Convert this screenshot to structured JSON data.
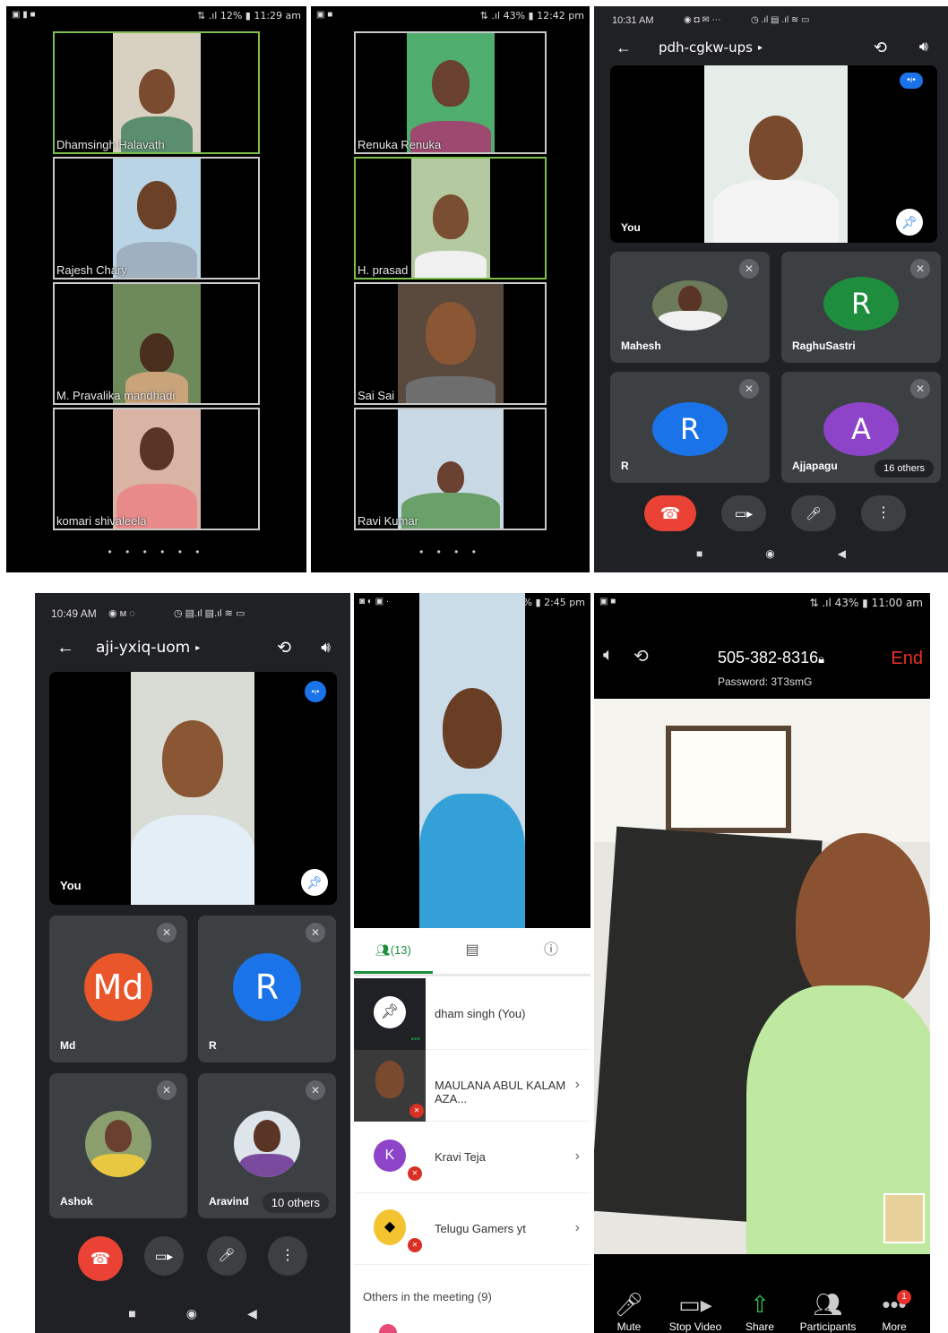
{
  "panel1": {
    "status_right": "⇅ .ıl 12% ▮ 11:29 am",
    "tiles": [
      {
        "name": "Dhamsingh Halavath"
      },
      {
        "name": "Rajesh Chary"
      },
      {
        "name": "M. Pravalika mandhadi"
      },
      {
        "name": "komari shivaleela"
      }
    ],
    "dots": "• • • • • •"
  },
  "panel2": {
    "status_right": "⇅ .ıl 43% ▮ 12:42 pm",
    "tiles": [
      {
        "name": "Renuka Renuka"
      },
      {
        "name": "H. prasad"
      },
      {
        "name": "Sai Sai"
      },
      {
        "name": "Ravi Kumar"
      }
    ],
    "dots": "• • • •"
  },
  "panel3": {
    "time": "10:31 AM",
    "title": "pdh-cgkw-ups",
    "self_label": "You",
    "participants": [
      {
        "name": "Mahesh",
        "letter": ""
      },
      {
        "name": "RaghuSastri",
        "letter": "R",
        "color": "#1e8e3e"
      },
      {
        "name": "R",
        "letter": "R",
        "color": "#1a73e8"
      },
      {
        "name": "Ajjapagu",
        "letter": "A",
        "color": "#8e44c9"
      }
    ],
    "others": "16 others"
  },
  "panel4": {
    "time": "10:49 AM",
    "title": "aji-yxiq-uom",
    "self_label": "You",
    "participants": [
      {
        "name": "Md",
        "letter": "Md",
        "color": "#e8562a"
      },
      {
        "name": "R",
        "letter": "R",
        "color": "#1a73e8"
      },
      {
        "name": "Ashok",
        "letter": ""
      },
      {
        "name": "Aravind",
        "letter": ""
      }
    ],
    "others": "10 others"
  },
  "panel5": {
    "status_right": "⇅ .ıl 42% ▮ 2:45 pm",
    "participants_count": "(13)",
    "rows": [
      {
        "name": "dham singh (You)",
        "letter": ""
      },
      {
        "name": "MAULANA ABUL KALAM AZA...",
        "letter": ""
      },
      {
        "name": "Kravi Teja",
        "letter": "K"
      },
      {
        "name": "Telugu Gamers yt",
        "letter": ""
      }
    ],
    "others_heading": "Others in the meeting (9)"
  },
  "panel6": {
    "status_right": "⇅ .ıl 43% ▮ 11:00 am",
    "meeting_id": "505-382-8316",
    "password": "Password: 3T3smG",
    "end_label": "End",
    "buttons": [
      {
        "label": "Mute"
      },
      {
        "label": "Stop Video"
      },
      {
        "label": "Share"
      },
      {
        "label": "Participants"
      },
      {
        "label": "More"
      }
    ],
    "badge": "1"
  }
}
